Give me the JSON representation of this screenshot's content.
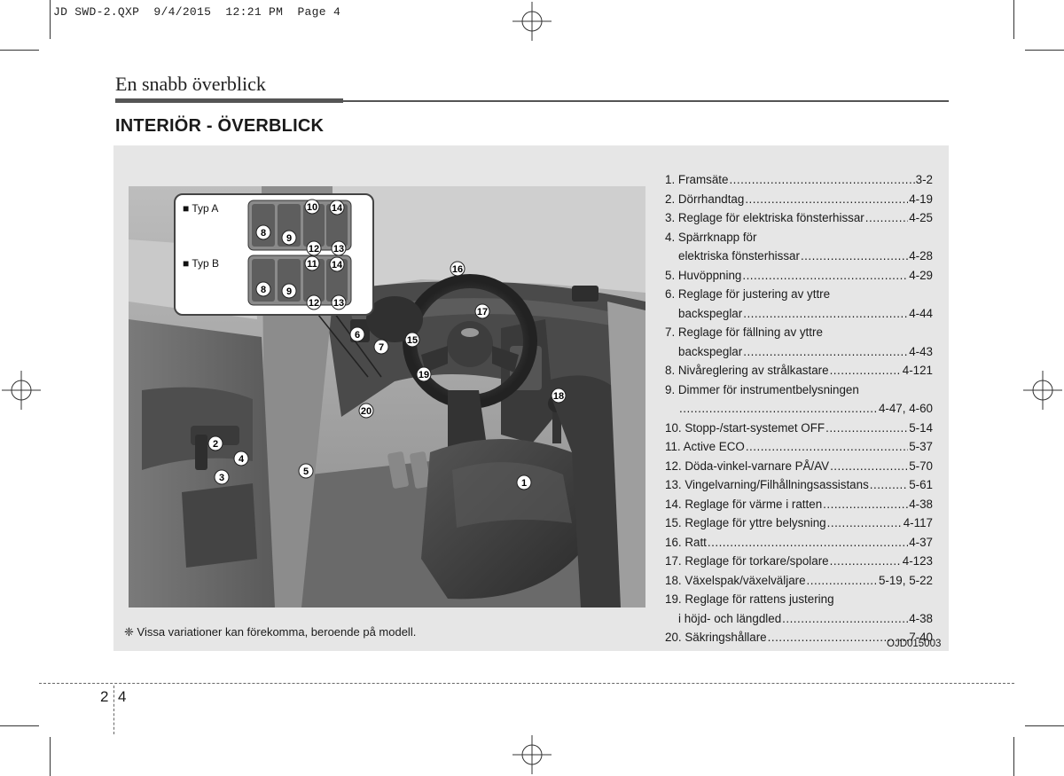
{
  "slug": "JD SWD-2.QXP  9/4/2015  12:21 PM  Page 4",
  "header": {
    "chapter_title": "En snabb överblick"
  },
  "section": {
    "title": "INTERIÖR - ÖVERBLICK"
  },
  "callout": {
    "type_a": "■ Typ A",
    "type_b": "■ Typ B"
  },
  "callout_numbers": {
    "a": [
      "8",
      "9",
      "10",
      "14",
      "12",
      "13"
    ],
    "b": [
      "8",
      "9",
      "11",
      "14",
      "12",
      "13"
    ]
  },
  "figure_numbers": [
    "1",
    "2",
    "3",
    "4",
    "5",
    "6",
    "7",
    "15",
    "16",
    "17",
    "18",
    "19",
    "20"
  ],
  "toc": [
    {
      "lines": [
        "1. Framsäte"
      ],
      "page": "3-2"
    },
    {
      "lines": [
        "2. Dörrhandtag"
      ],
      "page": "4-19"
    },
    {
      "lines": [
        "3. Reglage för elektriska fönsterhissar"
      ],
      "page": "4-25"
    },
    {
      "lines": [
        "4. Spärrknapp för",
        "elektriska fönsterhissar"
      ],
      "page": "4-28"
    },
    {
      "lines": [
        "5. Huvöppning"
      ],
      "page": "4-29"
    },
    {
      "lines": [
        "6. Reglage för justering av yttre",
        "backspeglar"
      ],
      "page": "4-44"
    },
    {
      "lines": [
        "7. Reglage för fällning av yttre",
        "backspeglar"
      ],
      "page": "4-43"
    },
    {
      "lines": [
        "8. Nivåreglering av strålkastare"
      ],
      "page": "4-121"
    },
    {
      "lines": [
        "9. Dimmer för instrumentbelysningen",
        ""
      ],
      "page": "4-47, 4-60"
    },
    {
      "lines": [
        "10. Stopp-/start-systemet OFF"
      ],
      "page": "5-14"
    },
    {
      "lines": [
        "11. Active ECO"
      ],
      "page": "5-37"
    },
    {
      "lines": [
        "12. Döda-vinkel-varnare PÅ/AV"
      ],
      "page": "5-70"
    },
    {
      "lines": [
        "13. Vingelvarning/Filhållningsassistans"
      ],
      "page": "5-61"
    },
    {
      "lines": [
        "14. Reglage för värme i ratten"
      ],
      "page": "4-38"
    },
    {
      "lines": [
        "15. Reglage för yttre belysning"
      ],
      "page": "4-117"
    },
    {
      "lines": [
        "16. Ratt"
      ],
      "page": "4-37"
    },
    {
      "lines": [
        "17. Reglage för torkare/spolare"
      ],
      "page": "4-123"
    },
    {
      "lines": [
        "18. Växelspak/växelväljare"
      ],
      "page": "5-19, 5-22"
    },
    {
      "lines": [
        "19. Reglage för rattens justering",
        "i höjd- och längdled"
      ],
      "page": "4-38"
    },
    {
      "lines": [
        "20. Säkringshållare"
      ],
      "page": "7-40"
    }
  ],
  "footnote": "❈ Vissa variationer kan förekomma, beroende på modell.",
  "figure_code": "OJD015003",
  "page_number": {
    "chapter": "2",
    "page": "4"
  }
}
